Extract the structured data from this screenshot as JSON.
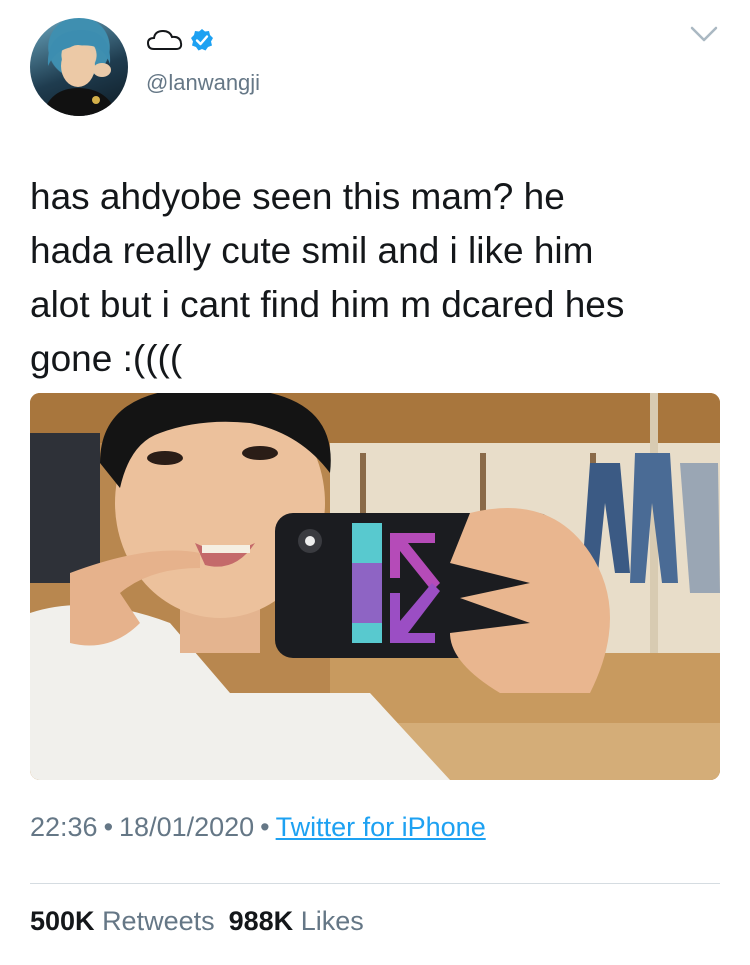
{
  "tweet": {
    "display_name_icon": "cloud-icon",
    "verified_icon": "verified-badge-icon",
    "handle": "@lanwangji",
    "text": "has ahdyobe seen this mam? he\nhada really cute smil and i like him\nalot but i cant find him m dcared hes\ngone :((((",
    "time": "22:36",
    "date": "18/01/2020",
    "separator": "•",
    "source": "Twitter for iPhone",
    "retweets_count": "500K",
    "retweets_label": "Retweets",
    "likes_count": "988K",
    "likes_label": "Likes"
  },
  "colors": {
    "link": "#1da1f2",
    "muted": "#657786",
    "verified": "#1da1f2"
  }
}
